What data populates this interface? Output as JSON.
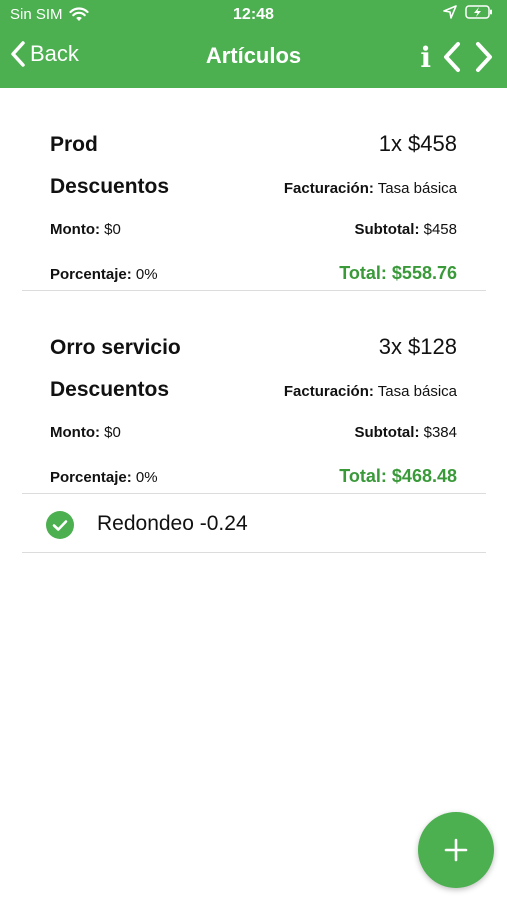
{
  "status_bar": {
    "carrier": "Sin SIM",
    "time": "12:48"
  },
  "nav": {
    "back_label": "Back",
    "title": "Artículos",
    "info_label": "i"
  },
  "labels": {
    "discounts": "Descuentos",
    "billing": "Facturación:",
    "amount": "Monto:",
    "subtotal": "Subtotal:",
    "percentage": "Porcentaje:"
  },
  "items": [
    {
      "name": "Prod",
      "qty_price": "1x $458",
      "billing_value": "Tasa básica",
      "amount_value": "$0",
      "subtotal_value": "$458",
      "percentage_value": "0%",
      "total": "Total: $558.76"
    },
    {
      "name": "Orro servicio",
      "qty_price": "3x $128",
      "billing_value": "Tasa básica",
      "amount_value": "$0",
      "subtotal_value": "$384",
      "percentage_value": "0%",
      "total": "Total: $468.48"
    }
  ],
  "rounding": {
    "label": "Redondeo -0.24"
  },
  "colors": {
    "accent": "#4caf50",
    "total_text": "#3a9a3a",
    "divider": "#dcdcdc"
  },
  "icons": [
    "wifi-icon",
    "location-arrow-icon",
    "battery-charging-icon",
    "chevron-left-icon",
    "chevron-right-icon",
    "check-circle-icon",
    "plus-icon"
  ]
}
